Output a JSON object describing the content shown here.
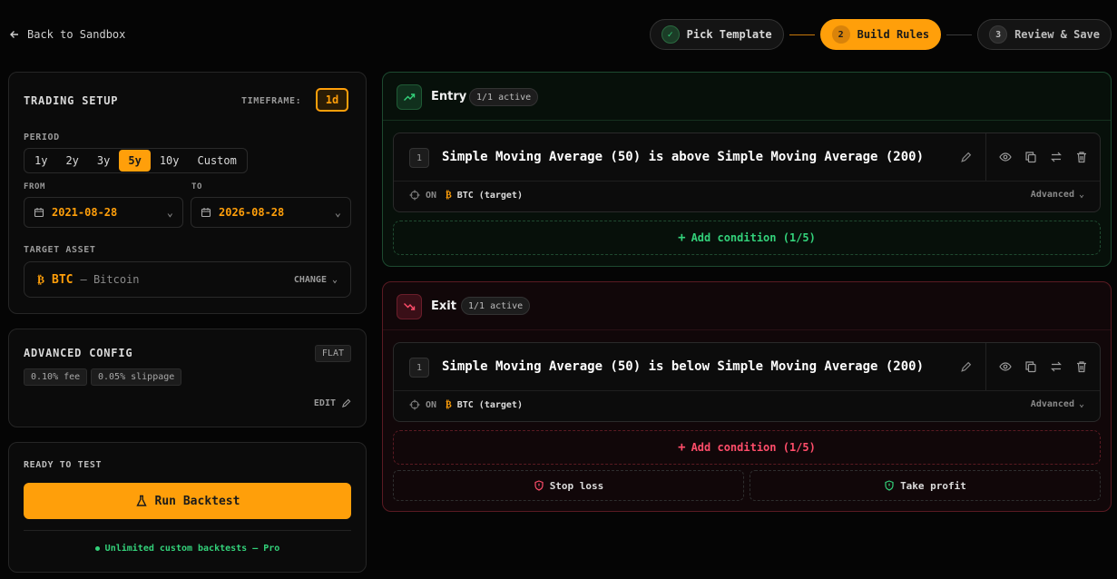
{
  "header": {
    "back_label": "Back to Sandbox",
    "steps": [
      {
        "num": "✓",
        "label": "Pick Template",
        "state": "done"
      },
      {
        "num": "2",
        "label": "Build Rules",
        "state": "active"
      },
      {
        "num": "3",
        "label": "Review & Save",
        "state": "todo"
      }
    ]
  },
  "setup": {
    "title": "TRADING SETUP",
    "timeframe_label": "TIMEFRAME:",
    "timeframe": "1d",
    "period_label": "PERIOD",
    "periods": [
      "1y",
      "2y",
      "3y",
      "5y",
      "10y",
      "Custom"
    ],
    "period_selected": "5y",
    "from_label": "FROM",
    "from": "2021-08-28",
    "to_label": "TO",
    "to": "2026-08-28",
    "asset_label": "TARGET ASSET",
    "asset_symbol": "BTC",
    "asset_name": "— Bitcoin",
    "change_label": "CHANGE"
  },
  "advanced": {
    "title": "ADVANCED CONFIG",
    "mode": "FLAT",
    "fee": "0.10% fee",
    "slippage": "0.05% slippage",
    "edit_label": "EDIT"
  },
  "run": {
    "ready_label": "READY TO TEST",
    "button_label": "Run Backtest",
    "promo": "Unlimited custom backtests — Pro"
  },
  "entry": {
    "title": "Entry",
    "badge": "1/1 active",
    "condition_num": "1",
    "condition_text": "Simple Moving Average (50) is above Simple Moving Average (200)",
    "on_label": "ON",
    "target": "BTC (target)",
    "advanced_label": "Advanced",
    "add_label": "Add condition (1/5)"
  },
  "exit": {
    "title": "Exit",
    "badge": "1/1 active",
    "condition_num": "1",
    "condition_text": "Simple Moving Average (50) is below Simple Moving Average (200)",
    "on_label": "ON",
    "target": "BTC (target)",
    "advanced_label": "Advanced",
    "add_label": "Add condition (1/5)",
    "stop_loss_label": "Stop loss",
    "take_profit_label": "Take profit"
  },
  "colors": {
    "accent": "#ff9f0a",
    "entry": "#33d17a",
    "exit": "#ff4d6a"
  }
}
